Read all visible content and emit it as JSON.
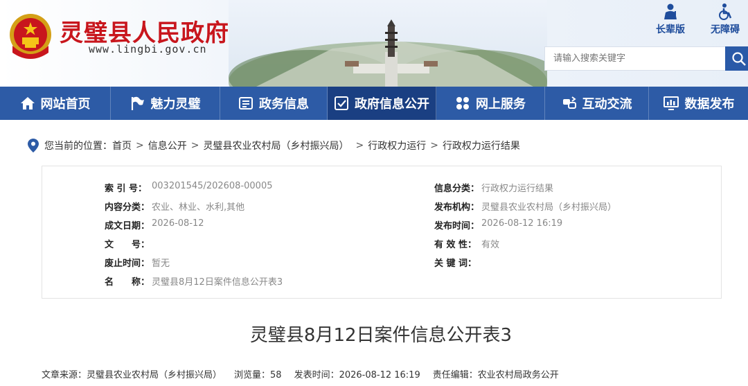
{
  "header": {
    "site_title": "灵璧县人民政府",
    "site_url": "www.lingbi.gov.cn",
    "tools": {
      "elder_label": "长辈版",
      "accessible_label": "无障碍"
    },
    "search": {
      "placeholder": "请输入搜索关键字"
    }
  },
  "nav": {
    "items": [
      {
        "label": "网站首页",
        "icon": "home-icon"
      },
      {
        "label": "魅力灵璧",
        "icon": "flag-icon"
      },
      {
        "label": "政务信息",
        "icon": "news-icon"
      },
      {
        "label": "政府信息公开",
        "icon": "info-open-icon"
      },
      {
        "label": "网上服务",
        "icon": "grid-icon"
      },
      {
        "label": "互动交流",
        "icon": "exchange-icon"
      },
      {
        "label": "数据发布",
        "icon": "monitor-icon"
      }
    ],
    "active_index": 3
  },
  "breadcrumb": {
    "prefix": "您当前的位置：",
    "items": [
      "首页",
      "信息公开",
      "灵璧县农业农村局（乡村振兴局）",
      "行政权力运行",
      "行政权力运行结果"
    ]
  },
  "info": {
    "index_no": {
      "label": "索 引 号：",
      "value": "003201545/202608-00005"
    },
    "category": {
      "label": "信息分类：",
      "value": "行政权力运行结果"
    },
    "content_type": {
      "label": "内容分类：",
      "value": "农业、林业、水利,其他"
    },
    "publisher": {
      "label": "发布机构：",
      "value": "灵璧县农业农村局（乡村振兴局）"
    },
    "written_date": {
      "label": "成文日期：",
      "value": "2026-08-12"
    },
    "publish_time": {
      "label": "发布时间：",
      "value": "2026-08-12 16:19"
    },
    "doc_no": {
      "label": "文　　号：",
      "value": ""
    },
    "validity": {
      "label": "有 效 性：",
      "value": "有效"
    },
    "expiry": {
      "label": "废止时间：",
      "value": "暂无"
    },
    "keywords": {
      "label": "关 键 词：",
      "value": ""
    },
    "name": {
      "label": "名　　称：",
      "value": "灵璧县8月12日案件信息公开表3"
    }
  },
  "article": {
    "title": "灵璧县8月12日案件信息公开表3",
    "meta": {
      "source": "文章来源：灵璧县农业农村局（乡村振兴局）",
      "views": "浏览量：58",
      "publish_time": "发表时间：2026-08-12 16:19",
      "editor": "责任编辑：农业农村局政务公开"
    }
  },
  "colors": {
    "brand_red": "#c8161d",
    "nav_blue": "#2d5ba6",
    "nav_active": "#1a3f82",
    "link_blue": "#1f4d9c"
  }
}
